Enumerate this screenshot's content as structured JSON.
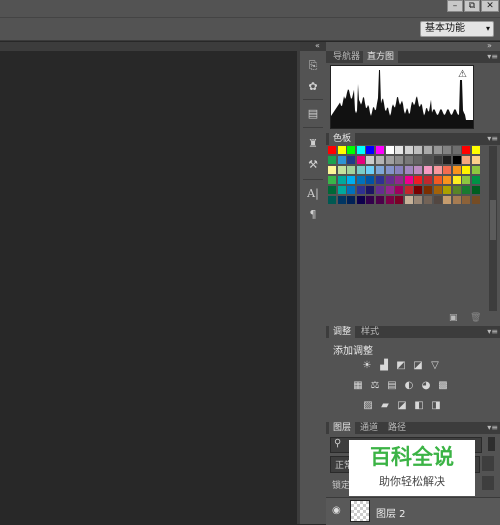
{
  "window": {
    "minimize": "–",
    "restore": "⧉",
    "close": "✕"
  },
  "options_bar": {
    "workspace": "基本功能",
    "workspace_arrow": "▾"
  },
  "panel_strip": {
    "collapse": "«",
    "expand": "»"
  },
  "tool_icons": [
    "history-icon",
    "brush-preset-icon",
    "swatch-icon",
    "clone-source-icon",
    "tool-preset-icon",
    "character-icon",
    "paragraph-icon"
  ],
  "navigator_panel": {
    "tabs": [
      "导航器",
      "直方图"
    ],
    "warning": "⚠"
  },
  "swatches_panel": {
    "tab": "色板",
    "rows": [
      [
        "#ff0000",
        "#ffff00",
        "#00ff00",
        "#00ffff",
        "#0000ff",
        "#ff00ff",
        "#ffffff",
        "#e6e6e6",
        "#d2d2d2",
        "#bebebe",
        "#aaaaaa",
        "#969696",
        "#828282",
        "#6e6e6e",
        "#ff0000",
        "#ffff00"
      ],
      [
        "#1aa14f",
        "#2d93d5",
        "#1e3a8a",
        "#e6007e",
        "#cccccc",
        "#b4b4b4",
        "#a0a0a0",
        "#8c8c8c",
        "#787878",
        "#646464",
        "#505050",
        "#3c3c3c",
        "#1e1e1e",
        "#000000",
        "#f5a77f",
        "#fbd08b"
      ],
      [
        "#fdf598",
        "#c5e19e",
        "#a3d39c",
        "#7accc8",
        "#6dcff6",
        "#7ea7d8",
        "#8493ca",
        "#8781bd",
        "#a187be",
        "#bd8cbf",
        "#f49ac1",
        "#f6989d",
        "#f26c4f",
        "#f7941d",
        "#fff200",
        "#8dc63f"
      ],
      [
        "#39b54a",
        "#00a99d",
        "#00aeef",
        "#0072bc",
        "#0054a6",
        "#2e3192",
        "#662d91",
        "#92278f",
        "#ec008c",
        "#ed1c24",
        "#c1272d",
        "#f15a24",
        "#f7931e",
        "#fcee21",
        "#8cc63f",
        "#009245"
      ],
      [
        "#006837",
        "#00a99d",
        "#0071bc",
        "#2e3192",
        "#1b1464",
        "#662d91",
        "#93278f",
        "#9e005d",
        "#c1272d",
        "#790000",
        "#7b2e00",
        "#a36209",
        "#aba000",
        "#598527",
        "#197b30",
        "#005e20"
      ],
      [
        "#005952",
        "#003663",
        "#002157",
        "#0d004c",
        "#32004b",
        "#4b0049",
        "#7b0046",
        "#7a0026",
        "#c7b299",
        "#998675",
        "#736357",
        "#534741",
        "#c69c6d",
        "#a67c52",
        "#8c6239",
        "#754c24"
      ]
    ]
  },
  "adjustments_panel": {
    "tabs": [
      "调整",
      "样式"
    ],
    "title": "添加调整",
    "row1": [
      "☀",
      "▟",
      "◩",
      "◪",
      "▽"
    ],
    "row2": [
      "▦",
      "⚖",
      "▤",
      "◐",
      "◕",
      "▩"
    ],
    "row3": [
      "▨",
      "▰",
      "◪",
      "◧",
      "◨"
    ]
  },
  "layers_panel": {
    "tabs": [
      "图层",
      "通道",
      "路径"
    ],
    "search_icon": "⚲",
    "blend_mode": "正常",
    "lock_label": "锁定",
    "layer_name": "图层 2"
  },
  "swatch_footer": {
    "new": "▣",
    "delete": "🗑"
  },
  "watermark": {
    "line1": "百科全说",
    "line2": "助你轻松解决"
  }
}
